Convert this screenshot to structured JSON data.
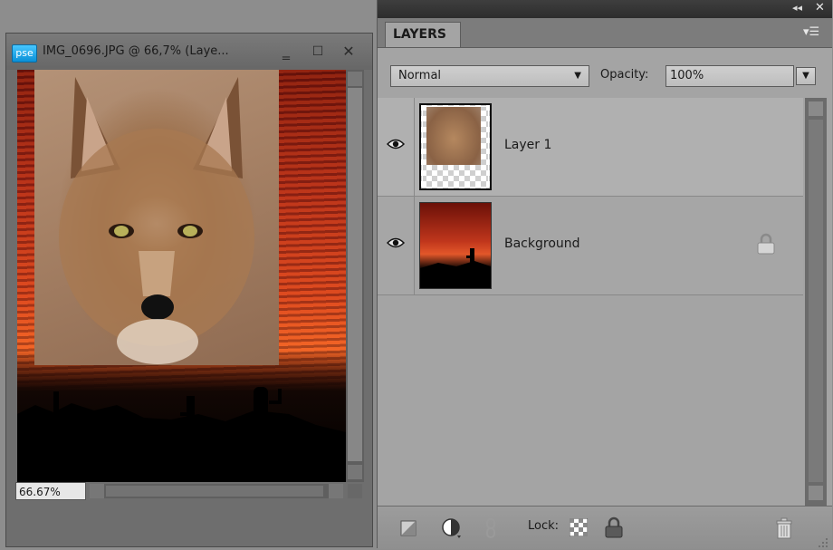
{
  "document_window": {
    "app_badge": "pse",
    "title": "IMG_0696.JPG @ 66,7% (Laye...",
    "minimize": "‗",
    "maximize": "☐",
    "close": "✕",
    "zoom": "66.67%",
    "image_layers": [
      "coyote portrait",
      "sunset with cacti silhouette"
    ]
  },
  "panel": {
    "collapse": "◂◂",
    "close": "✕",
    "tab_label": "LAYERS",
    "menu": "▾☰",
    "blend_mode": "Normal",
    "opacity_label": "Opacity:",
    "opacity_value": "100%",
    "dropdown_arrow": "▼",
    "layers": [
      {
        "name": "Layer 1",
        "visible": true,
        "selected": true,
        "locked": false
      },
      {
        "name": "Background",
        "visible": true,
        "selected": false,
        "locked": true
      }
    ],
    "lock_label": "Lock:"
  },
  "icons": {
    "eye": "eye-icon",
    "lock": "lock-icon",
    "trash": "trash-icon",
    "new_layer": "new-layer-icon",
    "adjustment": "adjustment-layer-icon",
    "link": "link-icon",
    "lock_transparent": "checkerboard-icon"
  },
  "colors": {
    "panel_bg": "#a4a4a4",
    "topbar": "#333333",
    "pse_blue": "#1aa3ee",
    "sunset_red": "#d84a22"
  }
}
